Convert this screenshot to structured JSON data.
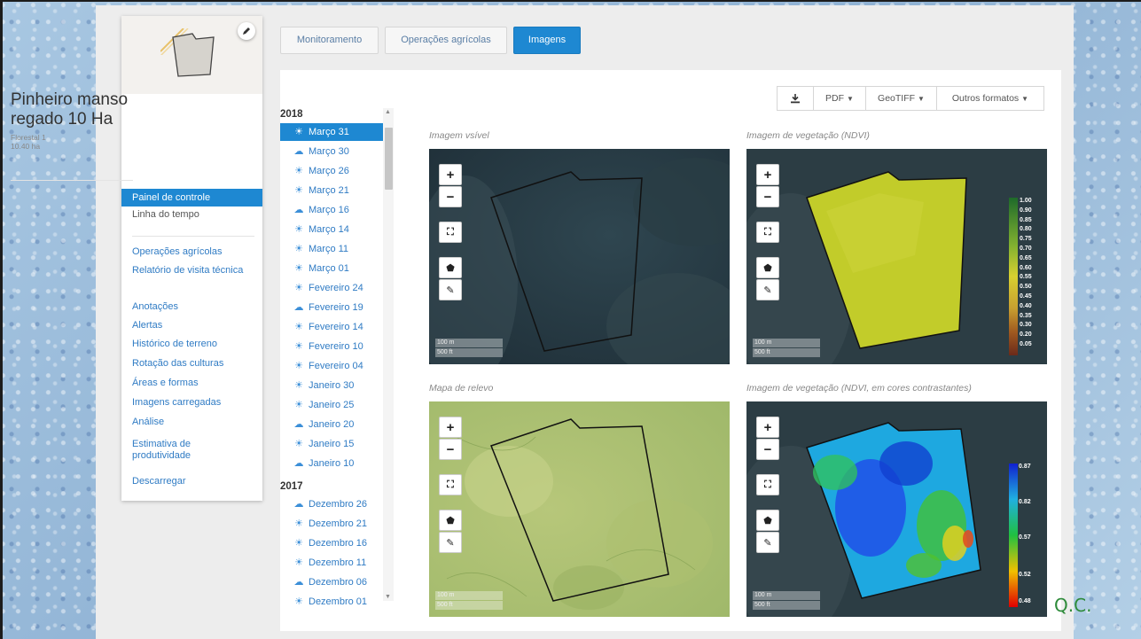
{
  "field": {
    "name": "Pinheiro manso regado 10 Ha",
    "subtitle": "Florestal 1",
    "area": "10.40 ha"
  },
  "nav": [
    {
      "label": "Painel de controle",
      "active": true
    },
    {
      "label": "Linha do tempo"
    },
    {
      "label": "Operações agrícolas"
    },
    {
      "label": "Relatório de visita técnica"
    },
    {
      "label": "Anotações"
    },
    {
      "label": "Alertas"
    },
    {
      "label": "Histórico de terreno"
    },
    {
      "label": "Rotação das culturas"
    },
    {
      "label": "Áreas e formas"
    },
    {
      "label": "Imagens carregadas"
    },
    {
      "label": "Análise"
    },
    {
      "label": "Estimativa de produtividade"
    },
    {
      "label": "Descarregar"
    }
  ],
  "tabs": [
    {
      "label": "Monitoramento"
    },
    {
      "label": "Operações agrícolas"
    },
    {
      "label": "Imagens",
      "active": true
    }
  ],
  "toolbar": {
    "download_icon": "download-icon",
    "pdf": "PDF",
    "geotiff": "GeoTIFF",
    "other": "Outros formatos"
  },
  "dates": {
    "years": [
      "2018",
      "2017"
    ],
    "items": [
      {
        "label": "Março 31",
        "icon": "sun",
        "active": true
      },
      {
        "label": "Março 30",
        "icon": "cloud"
      },
      {
        "label": "Março 26",
        "icon": "sun"
      },
      {
        "label": "Março 21",
        "icon": "sun"
      },
      {
        "label": "Março 16",
        "icon": "cloud"
      },
      {
        "label": "Março 14",
        "icon": "sun"
      },
      {
        "label": "Março 11",
        "icon": "sun"
      },
      {
        "label": "Março 01",
        "icon": "sun"
      },
      {
        "label": "Fevereiro 24",
        "icon": "sun"
      },
      {
        "label": "Fevereiro 19",
        "icon": "cloud"
      },
      {
        "label": "Fevereiro 14",
        "icon": "sun"
      },
      {
        "label": "Fevereiro 10",
        "icon": "sun"
      },
      {
        "label": "Fevereiro 04",
        "icon": "sun"
      },
      {
        "label": "Janeiro 30",
        "icon": "sun"
      },
      {
        "label": "Janeiro 25",
        "icon": "sun"
      },
      {
        "label": "Janeiro 20",
        "icon": "cloud"
      },
      {
        "label": "Janeiro 15",
        "icon": "sun"
      },
      {
        "label": "Janeiro 10",
        "icon": "cloud"
      },
      {
        "label": "Dezembro 26",
        "icon": "cloud"
      },
      {
        "label": "Dezembro 21",
        "icon": "sun"
      },
      {
        "label": "Dezembro 16",
        "icon": "sun"
      },
      {
        "label": "Dezembro 11",
        "icon": "sun"
      },
      {
        "label": "Dezembro 06",
        "icon": "cloud"
      },
      {
        "label": "Dezembro 01",
        "icon": "sun"
      }
    ]
  },
  "maps": {
    "visible": {
      "caption": "Imagem vsível"
    },
    "ndvi": {
      "caption": "Imagem de vegetação (NDVI)"
    },
    "relief": {
      "caption": "Mapa de relevo"
    },
    "contrast": {
      "caption": "Imagem de vegetação (NDVI, em cores contrastantes)"
    },
    "scale_m": "100 m",
    "scale_ft": "500 ft",
    "ndvi_legend": [
      "1.00",
      "0.90",
      "0.85",
      "0.80",
      "0.75",
      "0.70",
      "0.65",
      "0.60",
      "0.55",
      "0.50",
      "0.45",
      "0.40",
      "0.35",
      "0.30",
      "0.20",
      "0.05"
    ],
    "contrast_legend": [
      "0.87",
      "0.82",
      "0.57",
      "0.52",
      "0.48"
    ]
  },
  "colors": {
    "accent": "#1e88d2",
    "link": "#2f7bc4",
    "watermark": "#2e8b3a"
  },
  "watermark": "Q.C."
}
